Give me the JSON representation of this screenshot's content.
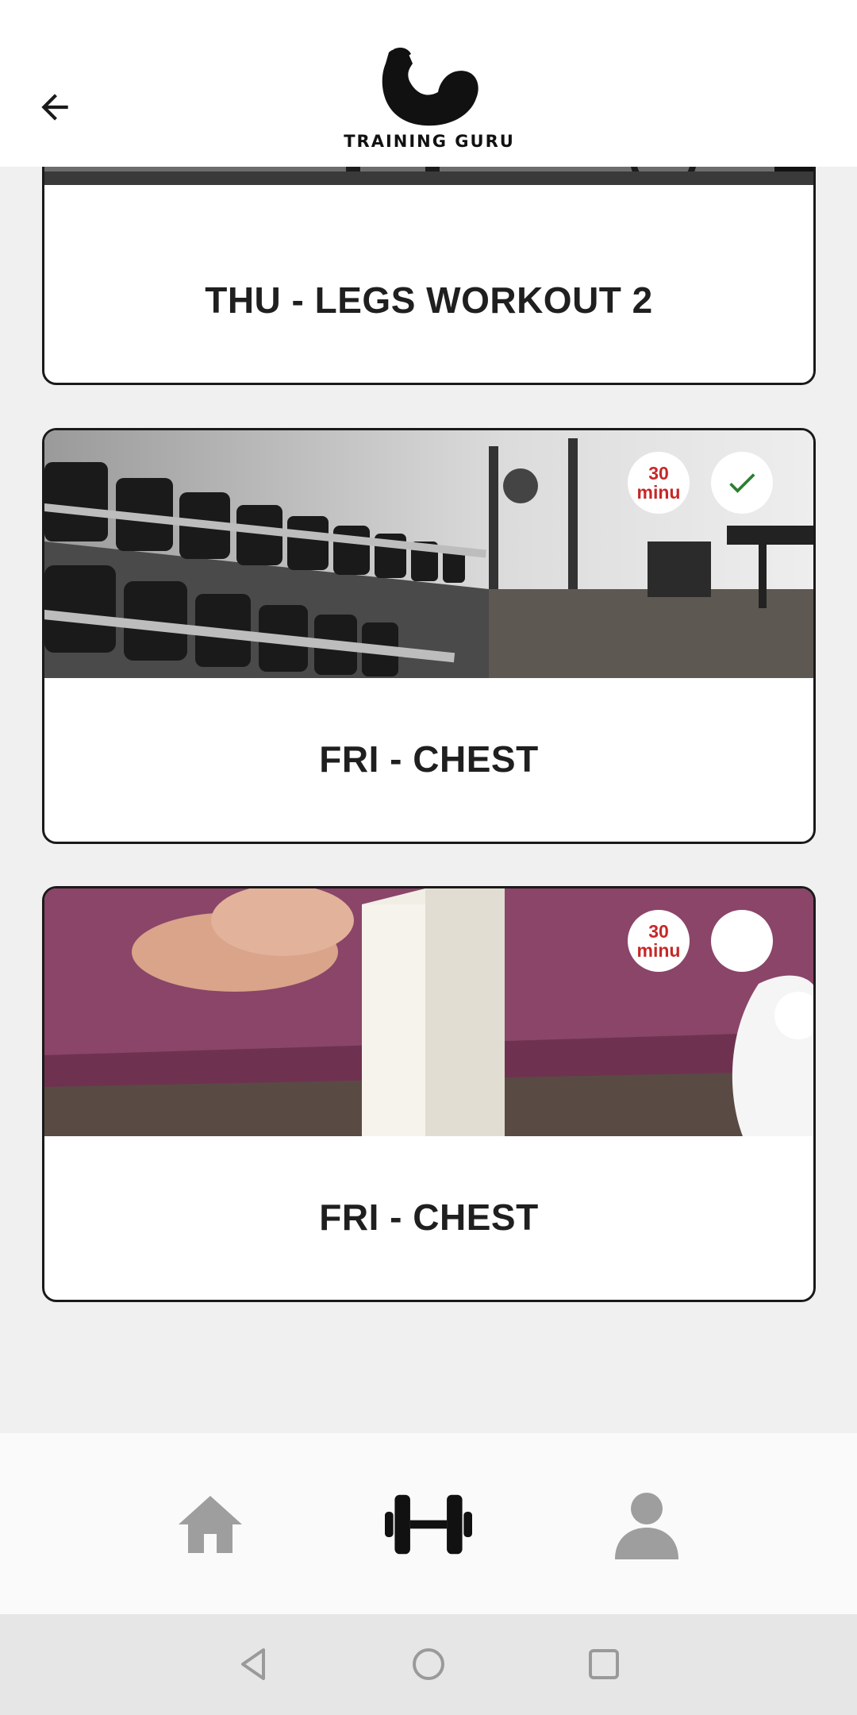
{
  "header": {
    "back_label": "Back",
    "logo_text": "TRAINING GURU"
  },
  "workouts": [
    {
      "title": "THU - LEGS WORKOUT 2",
      "image": "gym-benches-photo"
    },
    {
      "title": "FRI - CHEST",
      "image": "dumbbell-rack-photo",
      "duration_value": "30",
      "duration_unit": "minu",
      "completed": true
    },
    {
      "title": "FRI - CHEST",
      "image": "boxed-water-yoga-mat-photo",
      "duration_value": "30",
      "duration_unit": "minu",
      "completed": false
    }
  ],
  "bottom_nav": {
    "items": [
      {
        "icon": "home-icon",
        "active": false
      },
      {
        "icon": "dumbbell-icon",
        "active": true
      },
      {
        "icon": "person-icon",
        "active": false
      }
    ],
    "active_color": "#111111",
    "inactive_color": "#9e9e9e"
  },
  "system_nav": {
    "items": [
      "back-triangle-icon",
      "home-circle-icon",
      "recents-square-icon"
    ]
  },
  "colors": {
    "duration_text": "#c62828",
    "check": "#2e7d32",
    "card_border": "#1a1a1a"
  }
}
